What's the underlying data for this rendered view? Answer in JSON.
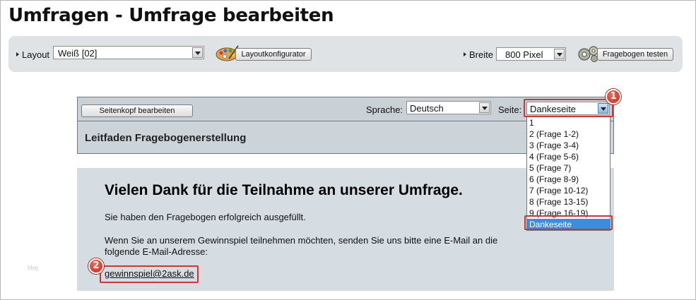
{
  "page": {
    "title": "Umfragen - Umfrage bearbeiten"
  },
  "toolbar": {
    "layout_label": "Layout",
    "layout_value": "Weiß [02]",
    "layout_config_button": "Layoutkonfigurator",
    "width_label": "Breite",
    "width_value": "800 Pixel",
    "test_button": "Fragebogen testen"
  },
  "editor": {
    "header_button": "Seitenkopf bearbeiten",
    "language_label": "Sprache:",
    "language_value": "Deutsch",
    "page_label": "Seite:",
    "page_value": "Dankeseite",
    "page_options": [
      "1",
      "2 (Frage 1-2)",
      "3 (Frage 3-4)",
      "4 (Frage 5-6)",
      "5 (Frage 7)",
      "6 (Frage 8-9)",
      "7 (Frage 10-12)",
      "8 (Frage 13-15)",
      "9 (Frage 16-19)",
      "Dankeseite"
    ],
    "page_options_selected_index": 9
  },
  "survey": {
    "section_title": "Leitfaden Fragebogenerstellung",
    "thanks_heading": "Vielen Dank für die Teilnahme an unserer Umfrage.",
    "completed_text": "Sie haben den Fragebogen erfolgreich ausgefüllt.",
    "prize_text_line1": "Wenn Sie an unserem Gewinnspiel teilnehmen möchten, senden Sie uns bitte eine E-Mail an die",
    "prize_text_line2": "folgende E-Mail-Adresse:",
    "email": "gewinnspiel@2ask.de"
  },
  "annotations": {
    "badge1": "1",
    "badge2": "2",
    "highlight_color": "#c43a3a"
  },
  "watermark": "blog",
  "colors": {
    "selection": "#3c8de0",
    "toolbar_bg": "#dfe3e6",
    "content_bg": "#d5dce2"
  }
}
